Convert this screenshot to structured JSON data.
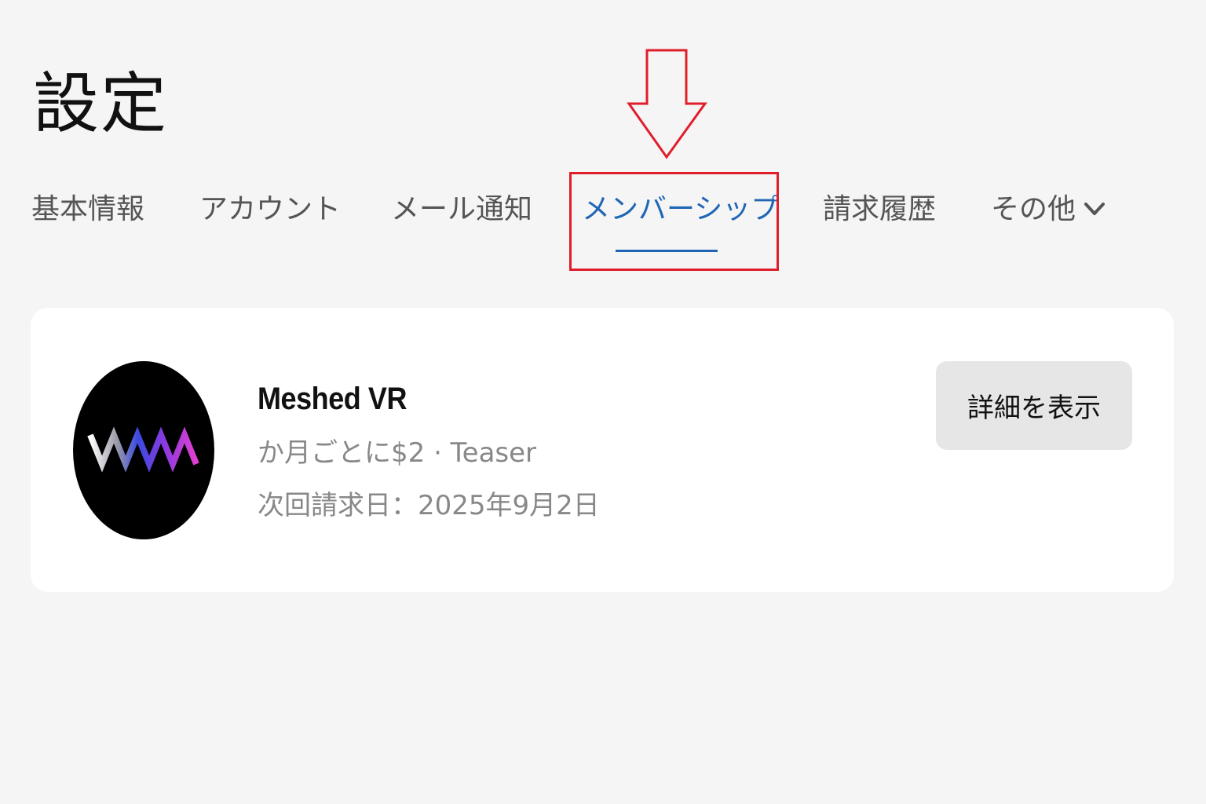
{
  "page": {
    "title": "設定"
  },
  "tabs": [
    {
      "label": "基本情報",
      "active": false
    },
    {
      "label": "アカウント",
      "active": false
    },
    {
      "label": "メール通知",
      "active": false
    },
    {
      "label": "メンバーシップ",
      "active": true
    },
    {
      "label": "請求履歴",
      "active": false
    },
    {
      "label": "その他",
      "active": false,
      "icon": "chevron-down-icon"
    }
  ],
  "membership": {
    "logo_icon": "meshed-vr-logo",
    "name": "Meshed VR",
    "price_line": "か月ごとに$2 · Teaser",
    "next_billing": "次回請求日：2025年9月2日",
    "details_button": "詳細を表示"
  },
  "colors": {
    "accent": "#1f66b5",
    "annotation": "#e01e2b",
    "background": "#f5f5f5",
    "card": "#ffffff",
    "button": "#e6e6e6"
  }
}
